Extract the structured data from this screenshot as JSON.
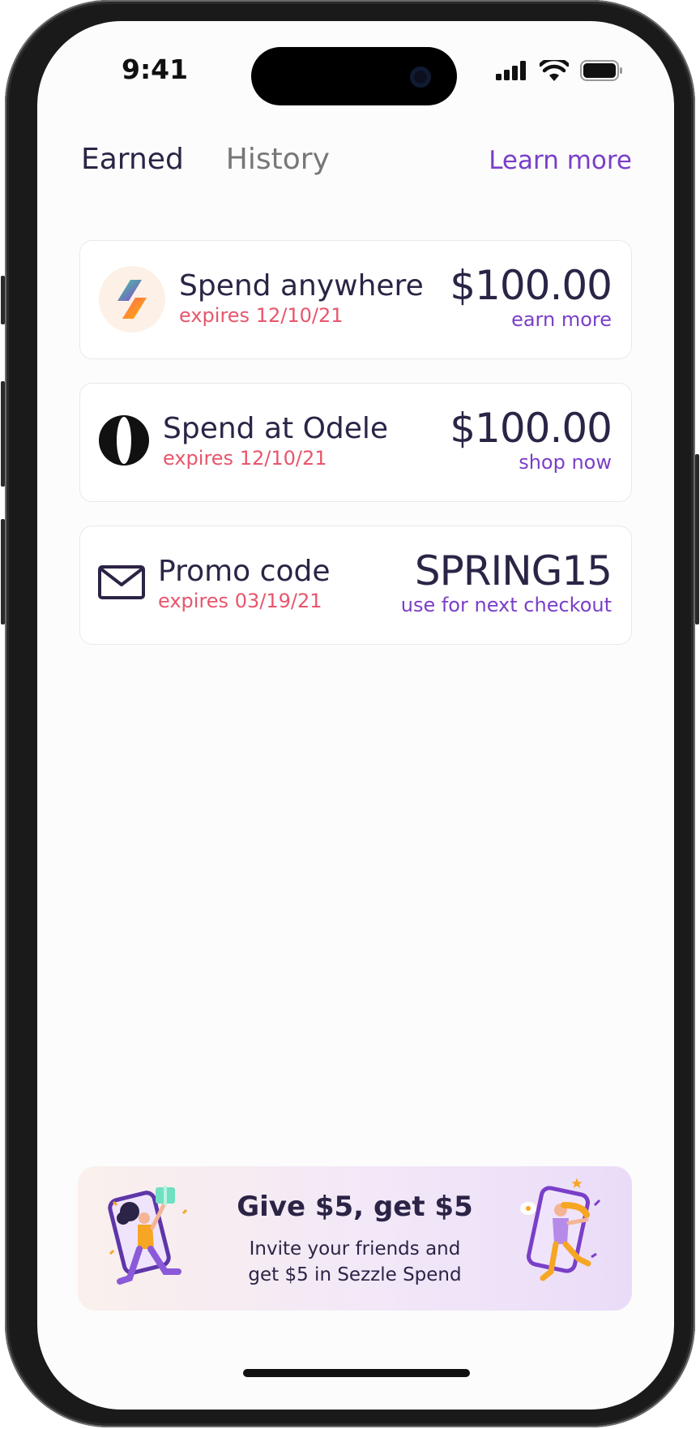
{
  "status_bar": {
    "time": "9:41"
  },
  "tabs": [
    {
      "label": "Earned",
      "active": true
    },
    {
      "label": "History",
      "active": false
    }
  ],
  "learn_more": "Learn more",
  "cards": [
    {
      "icon": "sezzle-logo-icon",
      "title": "Spend anywhere",
      "expires": "expires 12/10/21",
      "amount": "$100.00",
      "action": "earn more"
    },
    {
      "icon": "odele-logo-icon",
      "title": "Spend at Odele",
      "expires": "expires 12/10/21",
      "amount": "$100.00",
      "action": "shop now"
    },
    {
      "icon": "envelope-icon",
      "title": "Promo code",
      "expires": "expires 03/19/21",
      "amount": "SPRING15",
      "action": "use for next checkout"
    }
  ],
  "referral": {
    "title": "Give $5, get $5",
    "line1": "Invite your friends and",
    "line2": "get $5 in Sezzle Spend"
  },
  "colors": {
    "accent": "#7a3fc8",
    "expires": "#e8566c",
    "text": "#2c2446"
  }
}
